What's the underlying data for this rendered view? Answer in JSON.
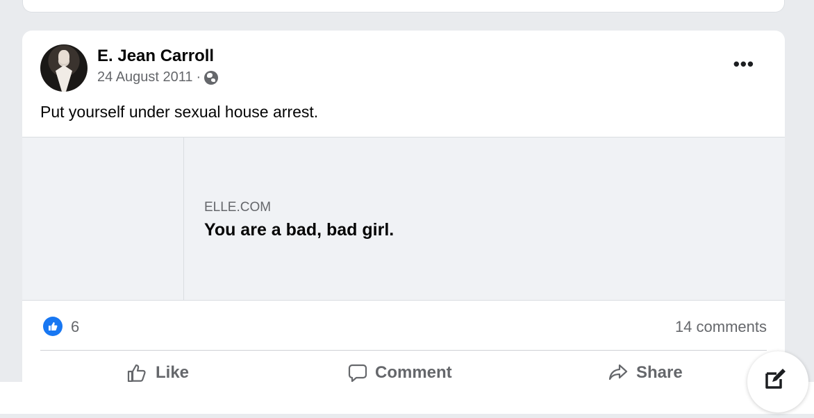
{
  "post": {
    "author": "E. Jean Carroll",
    "date": "24 August 2011",
    "separator": "·",
    "privacy_icon": "globe-icon",
    "more_icon": "•••",
    "text": "Put yourself under sexual house arrest."
  },
  "link_preview": {
    "domain": "ELLE.COM",
    "title": "You are a bad, bad girl."
  },
  "stats": {
    "reaction_icon": "like-icon",
    "likes": "6",
    "comments": "14 comments"
  },
  "actions": {
    "like": "Like",
    "comment": "Comment",
    "share": "Share"
  },
  "colors": {
    "brand_blue": "#1877f2",
    "secondary_text": "#65676b",
    "page_bg": "#e9ebee"
  }
}
